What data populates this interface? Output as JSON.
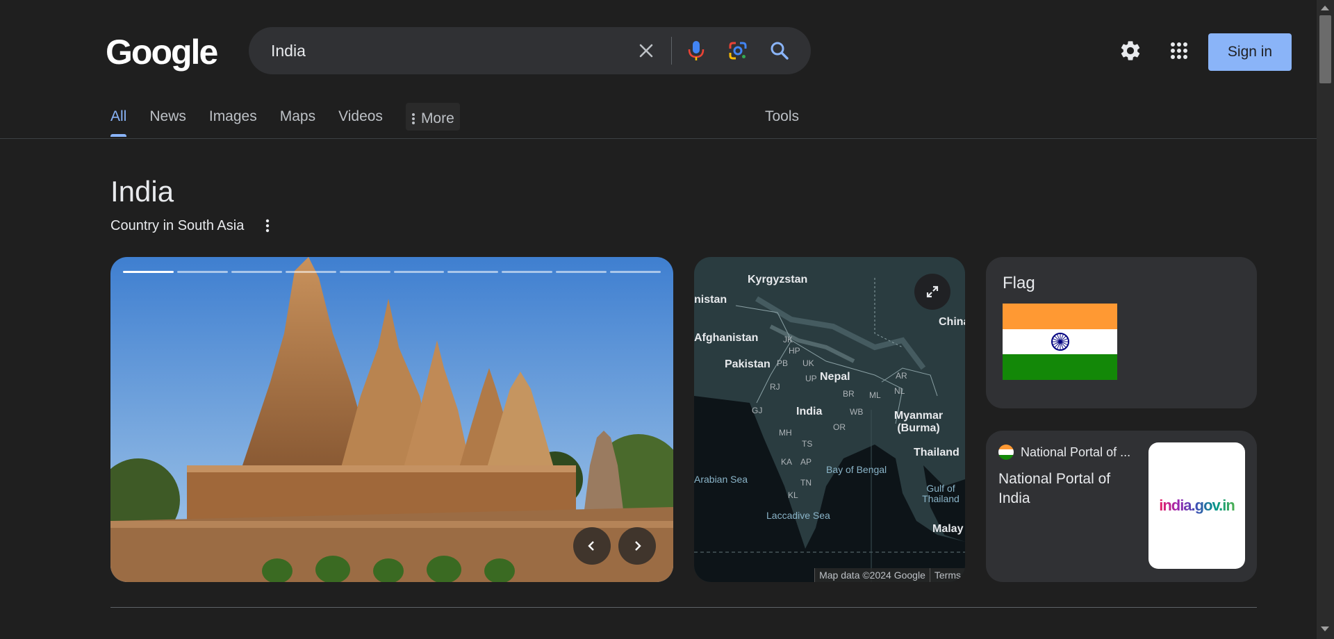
{
  "search": {
    "query": "India",
    "clear_label": "Clear",
    "voice_label": "Search by voice",
    "lens_label": "Search by image",
    "submit_label": "Search"
  },
  "header": {
    "logo_text": "Google",
    "signin_label": "Sign in"
  },
  "tabs": [
    {
      "label": "All",
      "active": true
    },
    {
      "label": "News"
    },
    {
      "label": "Images"
    },
    {
      "label": "Maps"
    },
    {
      "label": "Videos"
    },
    {
      "label": "More"
    }
  ],
  "tools_label": "Tools",
  "knowledge": {
    "title": "India",
    "subtitle": "Country in South Asia",
    "carousel": {
      "current": 1,
      "total": 10
    },
    "map": {
      "labels": [
        "Kyrgyzstan",
        "nistan",
        "China",
        "Afghanistan",
        "Pakistan",
        "Nepal",
        "India",
        "Myanmar (Burma)",
        "Thailand",
        "Malay"
      ],
      "state_labels": [
        "JK",
        "HP",
        "PB",
        "UK",
        "UP",
        "RJ",
        "BR",
        "ML",
        "NL",
        "AR",
        "GJ",
        "WB",
        "MH",
        "OR",
        "TS",
        "KA",
        "AP",
        "TN",
        "KL"
      ],
      "seas": [
        "Arabian Sea",
        "Bay of Bengal",
        "Laccadive Sea",
        "Gulf of Thailand"
      ],
      "attribution": "Map data ©2024 Google",
      "terms": "Terms"
    },
    "flag": {
      "title": "Flag"
    },
    "portal": {
      "site": "National Portal of ...",
      "title": "National Portal of India",
      "thumb_text": "india.gov.in"
    }
  },
  "colors": {
    "background": "#1f1f1f",
    "accent": "#8ab4f8",
    "card": "#303134",
    "saffron": "#ff9933",
    "green": "#138808",
    "chakra": "#000080"
  }
}
